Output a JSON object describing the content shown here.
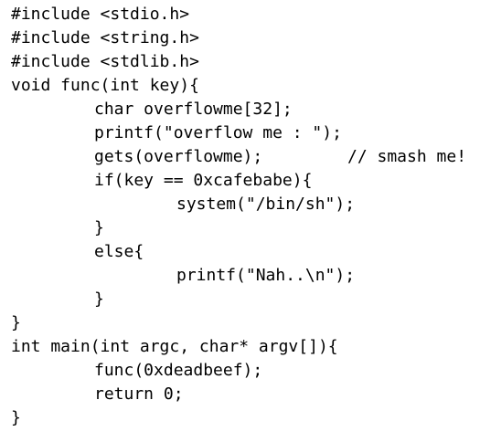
{
  "code_lines": [
    "#include <stdio.h>",
    "#include <string.h>",
    "#include <stdlib.h>",
    "void func(int key){",
    "char overflowme[32];",
    "printf(\"overflow me : \");",
    "gets(overflowme);",
    "if(key == 0xcafebabe){",
    "system(\"/bin/sh\");",
    "}",
    "else{",
    "printf(\"Nah..\\n\");",
    "}",
    "}",
    "int main(int argc, char* argv[]){",
    "func(0xdeadbeef);",
    "return 0;",
    "}"
  ],
  "comments": {
    "gets_line": "// smash me!"
  }
}
